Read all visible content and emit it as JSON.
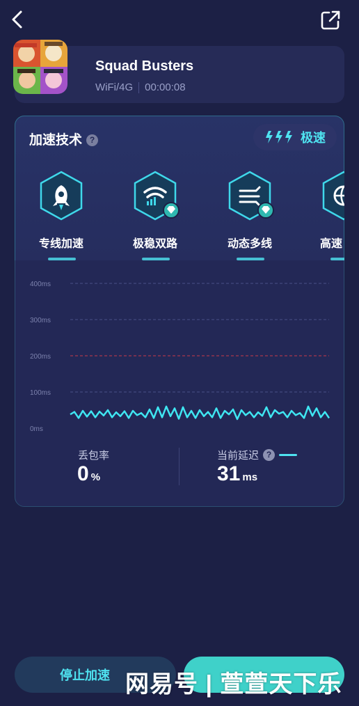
{
  "game": {
    "title": "Squad Busters",
    "network": "WiFi/4G",
    "timer": "00:00:08"
  },
  "tech": {
    "title": "加速技术",
    "help_glyph": "?",
    "speed_mode": "极速",
    "features": [
      {
        "label": "专线加速",
        "icon": "rocket-icon",
        "premium": false
      },
      {
        "label": "极稳双路",
        "icon": "wifi-icon",
        "premium": true
      },
      {
        "label": "动态多线",
        "icon": "multiline-icon",
        "premium": true
      },
      {
        "label": "高速",
        "icon": "globe-icon",
        "premium": false
      }
    ]
  },
  "chart_data": {
    "type": "line",
    "ylabel": "",
    "yticks": [
      "400ms",
      "300ms",
      "200ms",
      "100ms",
      "0ms"
    ],
    "ylim": [
      0,
      400
    ],
    "threshold": 200,
    "series": [
      {
        "values": [
          38,
          45,
          28,
          48,
          32,
          47,
          30,
          46,
          35,
          50,
          30,
          44,
          33,
          47,
          28,
          48,
          36,
          42,
          30,
          52,
          28,
          58,
          30,
          60,
          33,
          55,
          26,
          58,
          30,
          48,
          28,
          50,
          33,
          45,
          30,
          55,
          28,
          48,
          38,
          52,
          25,
          50,
          36,
          45,
          30,
          44,
          34,
          58,
          30,
          50,
          40,
          45,
          30,
          48,
          36,
          42,
          28,
          60,
          34,
          55,
          30,
          45,
          28
        ]
      }
    ],
    "grid": true,
    "colors": {
      "line": "#3fe6f2",
      "threshold": "#c83a4a",
      "grid": "#4a5088"
    }
  },
  "stats": {
    "packet_loss_label": "丢包率",
    "packet_loss_value": "0",
    "packet_loss_unit": "%",
    "latency_label": "当前延迟",
    "latency_value": "31",
    "latency_unit": "ms"
  },
  "actions": {
    "stop_label": "停止加速"
  },
  "watermark": "网易号 | 萱萱天下乐",
  "colors": {
    "background": "#1c2045",
    "card": "#262b57",
    "accent": "#4fe3f0"
  }
}
